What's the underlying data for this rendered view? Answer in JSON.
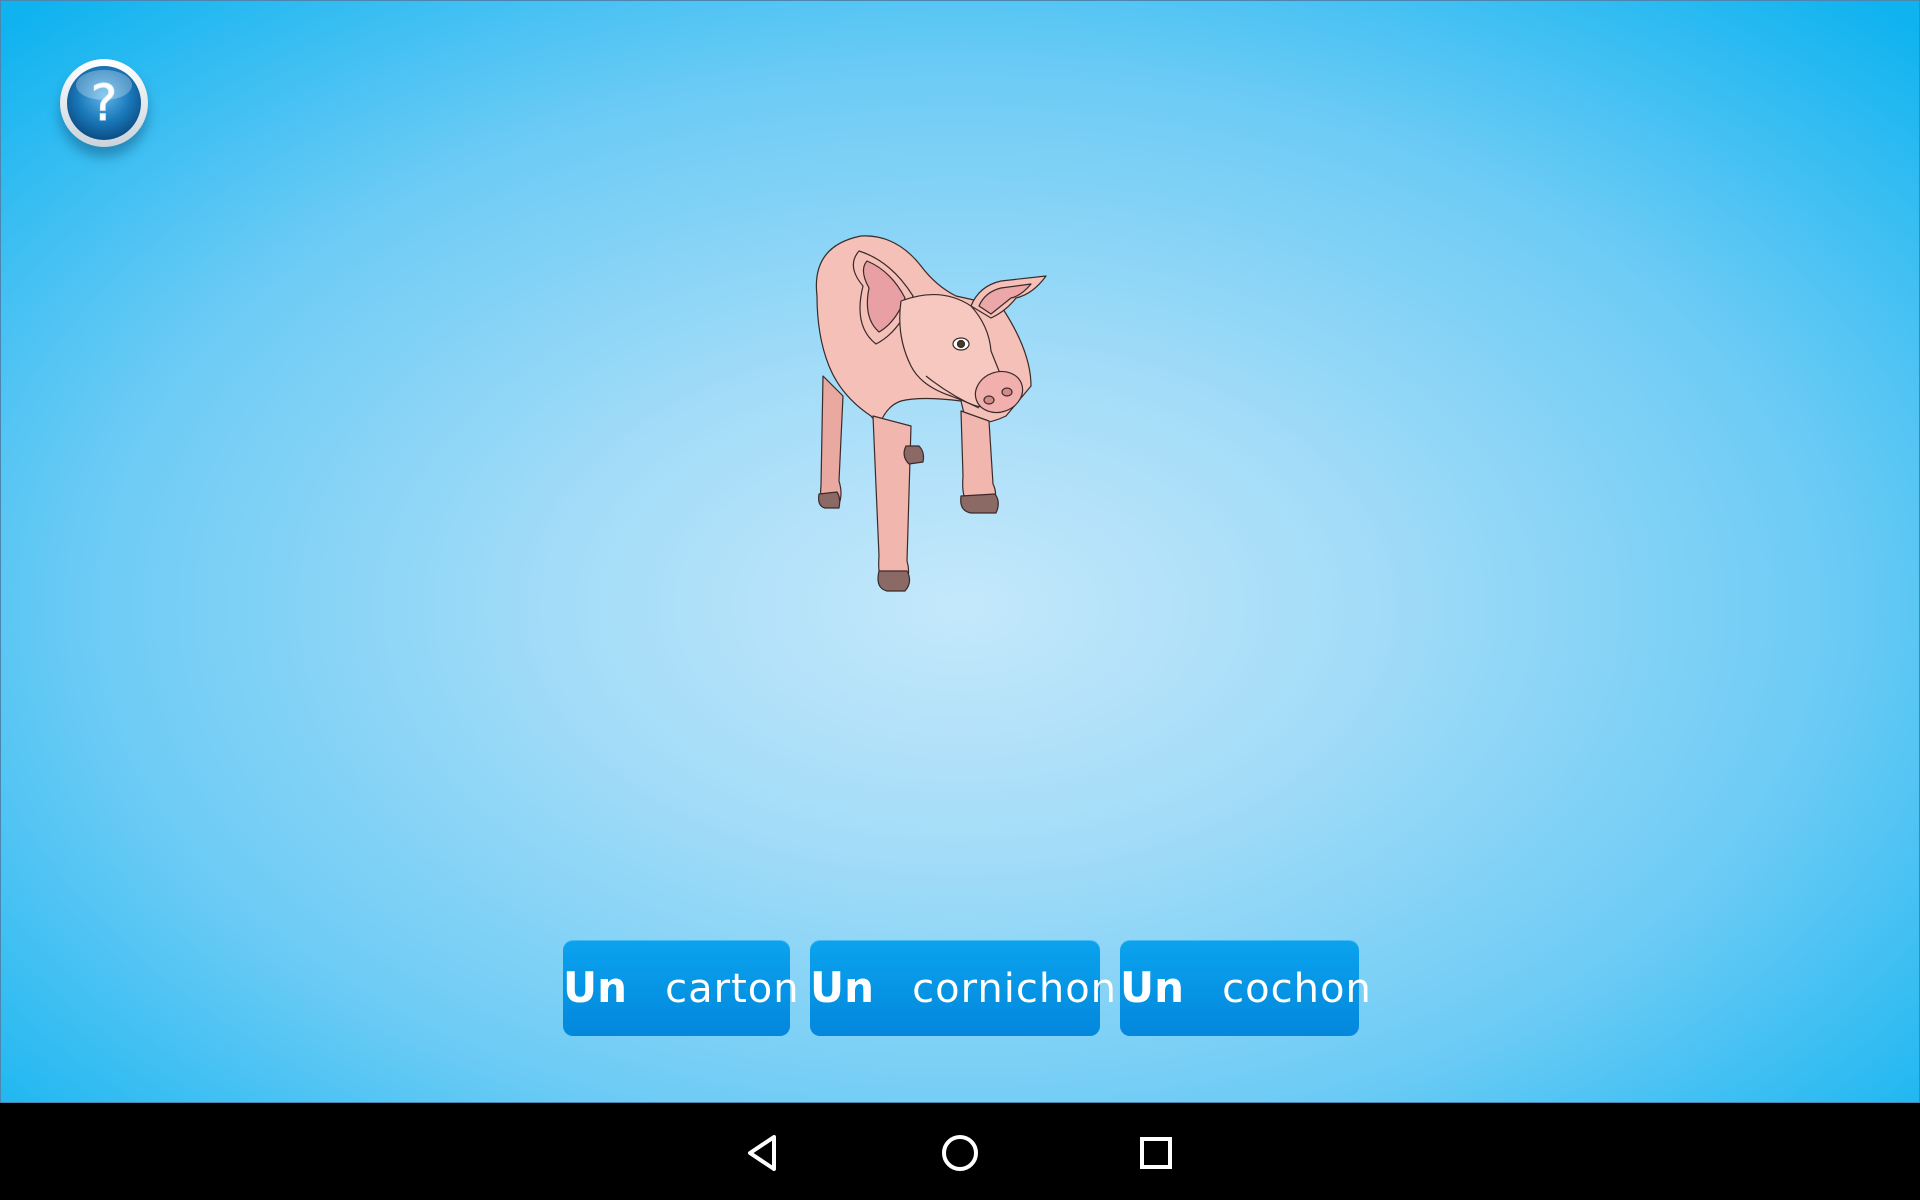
{
  "app": {
    "help_icon": "question-mark-icon",
    "help_symbol": "?",
    "illustration": "pig-illustration",
    "answers": [
      {
        "article": "Un",
        "word": "carton"
      },
      {
        "article": "Un",
        "word": "cornichon"
      },
      {
        "article": "Un",
        "word": "cochon"
      }
    ],
    "colors": {
      "background_center": "#c4e8fb",
      "background_edge": "#0fb3f0",
      "button": "#0596e6",
      "button_text": "#ffffff"
    }
  },
  "navbar": {
    "back_icon": "back-triangle-icon",
    "home_icon": "home-circle-icon",
    "recents_icon": "recents-square-icon"
  }
}
